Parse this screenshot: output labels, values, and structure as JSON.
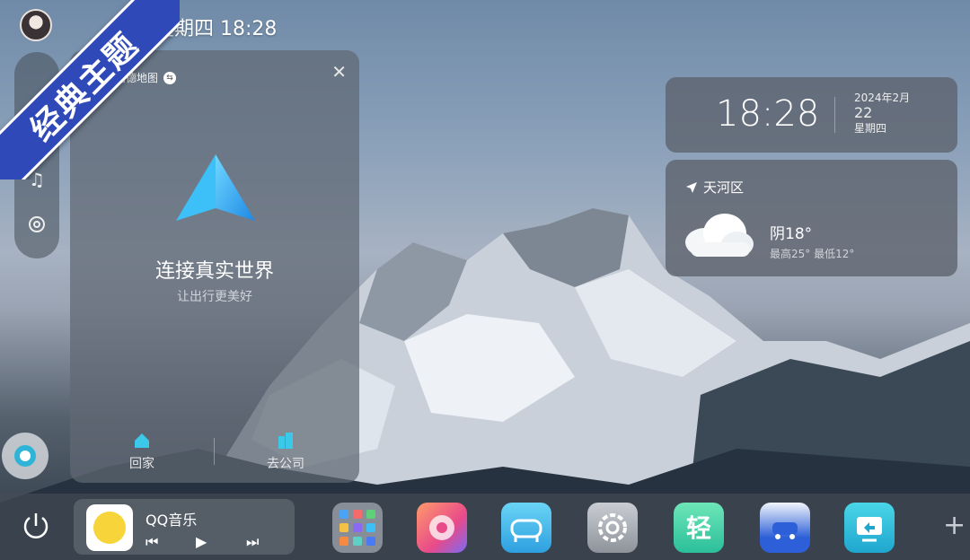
{
  "theme_ribbon": "经典主题",
  "status_bar": {
    "datetime": "星期四 18:28"
  },
  "nav_card": {
    "app_name": "高德地图",
    "title": "连接真实世界",
    "subtitle": "让出行更美好",
    "actions": [
      {
        "label": "回家"
      },
      {
        "label": "去公司"
      }
    ]
  },
  "clock_widget": {
    "time": "18:28",
    "year_month": "2024年2月",
    "day": "22",
    "weekday": "星期四"
  },
  "weather_widget": {
    "location": "天河区",
    "condition_temp": "阴18°",
    "range": "最高25° 最低12°"
  },
  "music": {
    "app_name": "QQ音乐"
  },
  "colors": {
    "ribbon": "#2f49b8",
    "nav_arrow": "#3cc0f7"
  }
}
